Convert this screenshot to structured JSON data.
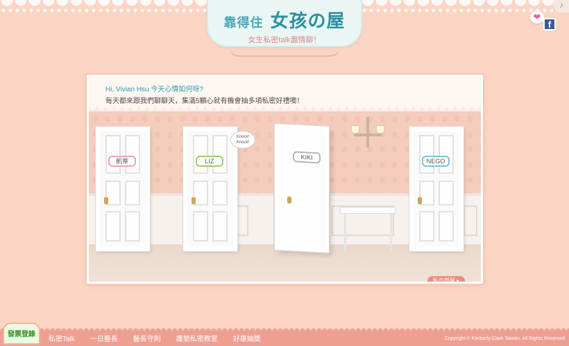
{
  "header": {
    "logo_title": "靠得住",
    "logo_title_main": "女孩の屋",
    "logo_subtitle": "女生私密talk盡情聊！"
  },
  "icons": {
    "heart": "heart-icon",
    "facebook": "facebook-icon",
    "music": "music-note-icon",
    "heart_glyph": "❤",
    "facebook_glyph": "f",
    "music_glyph": "♪"
  },
  "greeting": {
    "line1": "Hi, Vivian Hsu  今天心情如何呀?",
    "line2": "每天都來跟我們聊聊天，集滿5顆心就有機會抽多項私密好禮噢！"
  },
  "doors": [
    {
      "name": "凱蒂",
      "color": "#e9a3b8"
    },
    {
      "name": "LIZ",
      "color": "#9ccd6e"
    },
    {
      "name": "KIKI",
      "color": "#b6b6b6"
    },
    {
      "name": "NEGO",
      "color": "#7cc2de"
    }
  ],
  "bubble": "Knock! Knock!",
  "my_room": "私の部屋 ▸",
  "bottom": {
    "vote": "發票登錄",
    "nav": [
      "私密Talk",
      "一日藝長",
      "藝長守則",
      "護墊私密教室",
      "好康抽獎"
    ],
    "copyright": "Copyright © Kimberly-Clark Taiwan. All Rights Reserved"
  },
  "colors": {
    "background": "#fbd5c3",
    "accent_teal": "#2aa0b2",
    "bottom_bar": "#ee9f91"
  }
}
